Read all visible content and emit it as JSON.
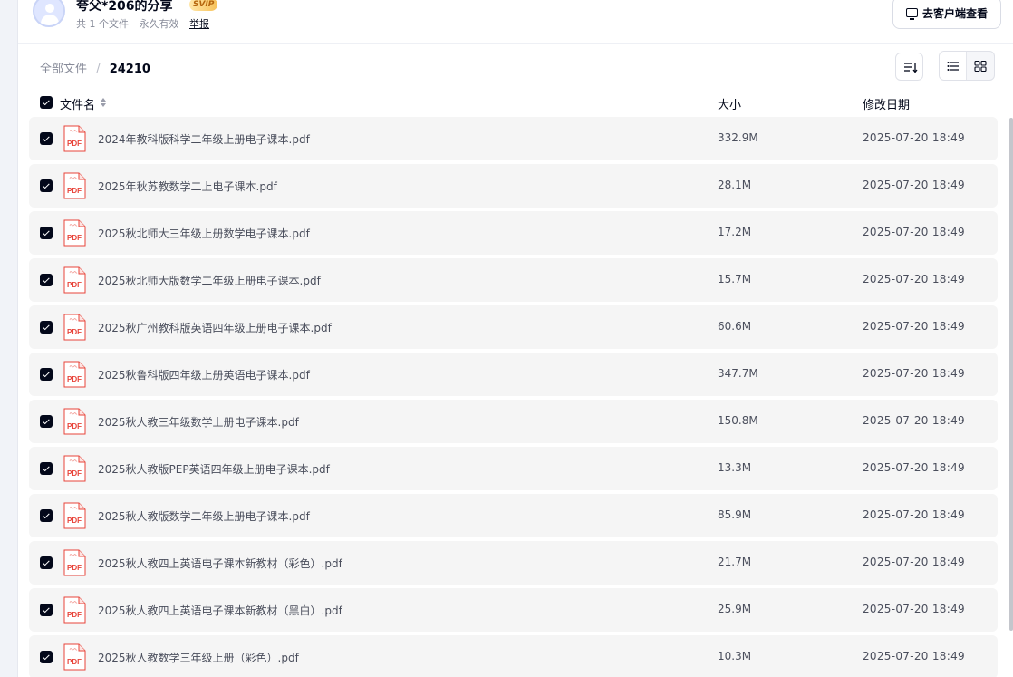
{
  "header": {
    "share_title": "夸父*206的分享",
    "svip_label": "SVIP",
    "file_count": "共 1 个文件",
    "validity": "永久有效",
    "report_label": "举报",
    "client_button_label": "去客户端查看"
  },
  "breadcrumb": {
    "root": "全部文件",
    "separator": "/",
    "current": "24210"
  },
  "table": {
    "col_name": "文件名",
    "col_size": "大小",
    "col_date": "修改日期"
  },
  "files": [
    {
      "name": "2024年教科版科学二年级上册电子课本.pdf",
      "size": "332.9M",
      "date": "2025-07-20 18:49"
    },
    {
      "name": "2025年秋苏教数学二上电子课本.pdf",
      "size": "28.1M",
      "date": "2025-07-20 18:49"
    },
    {
      "name": "2025秋北师大三年级上册数学电子课本.pdf",
      "size": "17.2M",
      "date": "2025-07-20 18:49"
    },
    {
      "name": "2025秋北师大版数学二年级上册电子课本.pdf",
      "size": "15.7M",
      "date": "2025-07-20 18:49"
    },
    {
      "name": "2025秋广州教科版英语四年级上册电子课本.pdf",
      "size": "60.6M",
      "date": "2025-07-20 18:49"
    },
    {
      "name": "2025秋鲁科版四年级上册英语电子课本.pdf",
      "size": "347.7M",
      "date": "2025-07-20 18:49"
    },
    {
      "name": "2025秋人教三年级数学上册电子课本.pdf",
      "size": "150.8M",
      "date": "2025-07-20 18:49"
    },
    {
      "name": "2025秋人教版PEP英语四年级上册电子课本.pdf",
      "size": "13.3M",
      "date": "2025-07-20 18:49"
    },
    {
      "name": "2025秋人教版数学二年级上册电子课本.pdf",
      "size": "85.9M",
      "date": "2025-07-20 18:49"
    },
    {
      "name": "2025秋人教四上英语电子课本新教材（彩色）.pdf",
      "size": "21.7M",
      "date": "2025-07-20 18:49"
    },
    {
      "name": "2025秋人教四上英语电子课本新教材（黑白）.pdf",
      "size": "25.9M",
      "date": "2025-07-20 18:49"
    },
    {
      "name": "2025秋人教数学三年级上册（彩色）.pdf",
      "size": "10.3M",
      "date": "2025-07-20 18:49"
    }
  ],
  "file_icon_label": "PDF",
  "colors": {
    "accent_dark": "#03081a",
    "row_bg": "#f5f5f5",
    "pdf_red": "#e8443a",
    "svip_gold": "#f7c25a"
  }
}
